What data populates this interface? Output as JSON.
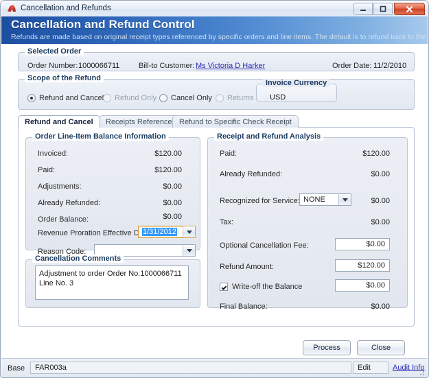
{
  "window": {
    "title": "Cancellation and Refunds",
    "icon": "app-icon",
    "minimize_label": "–",
    "maximize_label": "□",
    "close_label": "✕"
  },
  "banner": {
    "title": "Cancellation and Refund Control",
    "subtitle": "Refunds are made based on original receipt types referenced by specific orders and line items. The default is to refund back to the original receipt ty"
  },
  "selected_order": {
    "legend": "Selected Order",
    "order_number_label": "Order Number:",
    "order_number_value": "1000066711",
    "bill_to_label": "Bill-to Customer:",
    "bill_to_value": "Ms Victoria D Harker",
    "order_date_label": "Order Date:",
    "order_date_value": "11/2/2010"
  },
  "scope": {
    "legend": "Scope of the Refund",
    "options": [
      {
        "label": "Refund and Cancel",
        "selected": true,
        "disabled": false
      },
      {
        "label": "Refund Only",
        "selected": false,
        "disabled": true
      },
      {
        "label": "Cancel Only",
        "selected": false,
        "disabled": false
      },
      {
        "label": "Returns",
        "selected": false,
        "disabled": true
      }
    ],
    "currency_legend": "Invoice Currency",
    "currency_value": "USD"
  },
  "tabs": [
    {
      "label": "Refund and Cancel",
      "active": true
    },
    {
      "label": "Receipts Referenced",
      "active": false
    },
    {
      "label": "Refund to Specific Check Receipt",
      "active": false
    }
  ],
  "order_balance": {
    "legend": "Order Line-Item Balance Information",
    "rows": [
      {
        "label": "Invoiced:",
        "value": "$120.00"
      },
      {
        "label": "Paid:",
        "value": "$120.00"
      },
      {
        "label": "Adjustments:",
        "value": "$0.00"
      },
      {
        "label": "Already Refunded:",
        "value": "$0.00"
      },
      {
        "label": "Order Balance:",
        "value": "$0.00"
      }
    ],
    "proration_label": "Revenue Proration Effective Date:",
    "proration_value": "1/31/2012",
    "reason_code_label": "Reason Code:",
    "reason_code_value": ""
  },
  "comments": {
    "legend": "Cancellation Comments",
    "text": "Adjustment to order Order No.1000066711 Line No. 3"
  },
  "analysis": {
    "legend": "Receipt and Refund Analysis",
    "paid_label": "Paid:",
    "paid_value": "$120.00",
    "already_refunded_label": "Already Refunded:",
    "already_refunded_value": "$0.00",
    "recognized_label": "Recognized for Service:",
    "recognized_value": "NONE",
    "recognized_amount": "$0.00",
    "tax_label": "Tax:",
    "tax_value": "$0.00",
    "fee_label": "Optional Cancellation Fee:",
    "fee_value": "$0.00",
    "refund_amount_label": "Refund Amount:",
    "refund_amount_value": "$120.00",
    "writeoff_label": "Write-off the Balance",
    "writeoff_checked": true,
    "writeoff_value": "$0.00",
    "final_balance_label": "Final Balance:",
    "final_balance_value": "$0.00"
  },
  "actions": {
    "process_label": "Process",
    "close_label": "Close"
  },
  "statusbar": {
    "base_label": "Base",
    "base_value": "FAR003a",
    "edit_label": "Edit",
    "audit_label": "Audit Info"
  },
  "colors": {
    "banner_start": "#1c4ea0",
    "banner_end": "#a8c9ec",
    "link": "#2a2ab4",
    "legend_text": "#1c3c63",
    "selection": "#3399ff",
    "focus_border": "#d8a24a",
    "close_button": "#cf4224"
  }
}
